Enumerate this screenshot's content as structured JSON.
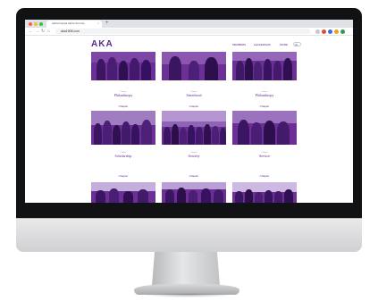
{
  "browser": {
    "tab_title": "Alpha Kappa Alpha Sorority",
    "tab_close": "×",
    "new_tab": "+",
    "back": "←",
    "forward": "→",
    "reload": "↻",
    "home": "⌂",
    "url": "aka1908.com"
  },
  "site": {
    "logo": "AKA",
    "nav": [
      "MEMBERS",
      "LEADERSHIP",
      "MORE"
    ]
  },
  "grid": {
    "row1": [
      {
        "small": "Chapter",
        "name": "Philanthropy"
      },
      {
        "small": "Chapter",
        "name": "Sisterhood"
      },
      {
        "small": "Chapter",
        "name": "Philanthropy"
      }
    ],
    "row2_labels": [
      "Chapter",
      "Chapter",
      "Chapter"
    ],
    "row2": [
      {
        "small": "Chapter",
        "name": "Scholarship"
      },
      {
        "small": "Chapter",
        "name": "Sorority"
      },
      {
        "small": "Chapter",
        "name": "Service"
      }
    ],
    "row3_labels": [
      "Chapter",
      "Chapter",
      "Chapter"
    ]
  }
}
